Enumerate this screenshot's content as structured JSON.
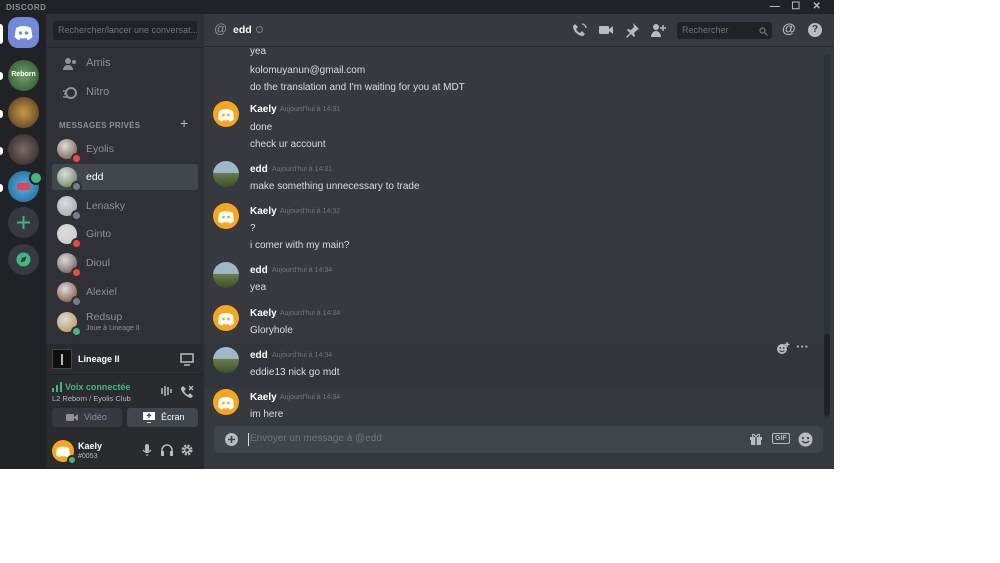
{
  "window": {
    "app_name": "DISCORD",
    "controls": {
      "minimize": "—",
      "maximize": "☐",
      "close": "✕"
    }
  },
  "servers": [
    {
      "name": "Discord Home",
      "icon": "discord-logo-icon",
      "color": "#7289da"
    },
    {
      "name": "Reborn",
      "icon_text": "Reborn",
      "color": "#3a6b39"
    },
    {
      "name": "Lineage",
      "color": "#6e4b25"
    },
    {
      "name": "Dark server",
      "color": "#4a3b3a"
    },
    {
      "name": "Mascot server",
      "color": "#2f86b7",
      "badge_color": "#43b581"
    },
    {
      "name": "Add a server",
      "icon": "plus-icon",
      "color": "#43b581"
    },
    {
      "name": "Explore",
      "icon": "compass-icon",
      "color": "#43b581"
    }
  ],
  "sidebar": {
    "search_placeholder": "Rechercher/lancer une conversat...",
    "nav": [
      {
        "label": "Amis",
        "icon": "friends-icon"
      },
      {
        "label": "Nitro",
        "icon": "nitro-icon"
      }
    ],
    "section_title": "MESSAGES PRIVÉS",
    "add_dm": "+",
    "dms": [
      {
        "name": "Eyolis",
        "status": "dnd",
        "active": false,
        "sub": ""
      },
      {
        "name": "edd",
        "status": "offline",
        "active": true,
        "sub": ""
      },
      {
        "name": "Lenasky",
        "status": "offline",
        "active": false,
        "sub": ""
      },
      {
        "name": "Ginto",
        "status": "dnd",
        "active": false,
        "sub": ""
      },
      {
        "name": "Dioul",
        "status": "dnd",
        "active": false,
        "sub": ""
      },
      {
        "name": "Alexiel",
        "status": "offline",
        "active": false,
        "sub": ""
      },
      {
        "name": "Redsup",
        "status": "online",
        "active": false,
        "sub": "Joue à Lineage II"
      }
    ],
    "status_colors": {
      "online": "#43b581",
      "dnd": "#f04747",
      "offline": "#747f8d"
    }
  },
  "activity": {
    "game": "Lineage II"
  },
  "voice": {
    "status": "Voix connectée",
    "channel": "L2 Reborn / Eyolis Club",
    "video_label": "Vidéo",
    "screen_label": "Écran"
  },
  "user": {
    "name": "Kaely",
    "tag": "#0053"
  },
  "chat": {
    "recipient": "edd",
    "search_placeholder": "Rechercher",
    "composer_placeholder": "Envoyer un message à @edd",
    "gif_label": "GIF",
    "messages": [
      {
        "author": "",
        "time": "",
        "lines": [
          "yea",
          "kolomuyanun@gmail.com",
          "do the translation and I'm waiting for you at MDT"
        ]
      },
      {
        "author": "Kaely",
        "time": "Aujourd'hui à 14:31",
        "lines": [
          "done",
          "check ur account"
        ]
      },
      {
        "author": "edd",
        "time": "Aujourd'hui à 14:31",
        "lines": [
          "make something unnecessary to trade"
        ]
      },
      {
        "author": "Kaely",
        "time": "Aujourd'hui à 14:32",
        "lines": [
          "?",
          "i comer with my main?"
        ]
      },
      {
        "author": "edd",
        "time": "Aujourd'hui à 14:34",
        "lines": [
          "yea"
        ]
      },
      {
        "author": "Kaely",
        "time": "Aujourd'hui à 14:34",
        "lines": [
          "Gloryhole"
        ]
      },
      {
        "author": "edd",
        "time": "Aujourd'hui à 14:34",
        "lines": [
          "eddie13 nick go mdt"
        ]
      },
      {
        "author": "Kaely",
        "time": "Aujourd'hui à 14:34",
        "lines": [
          "im here"
        ]
      }
    ],
    "hover_actions": {
      "react_icon": "add-reaction-icon",
      "more": "···"
    }
  }
}
